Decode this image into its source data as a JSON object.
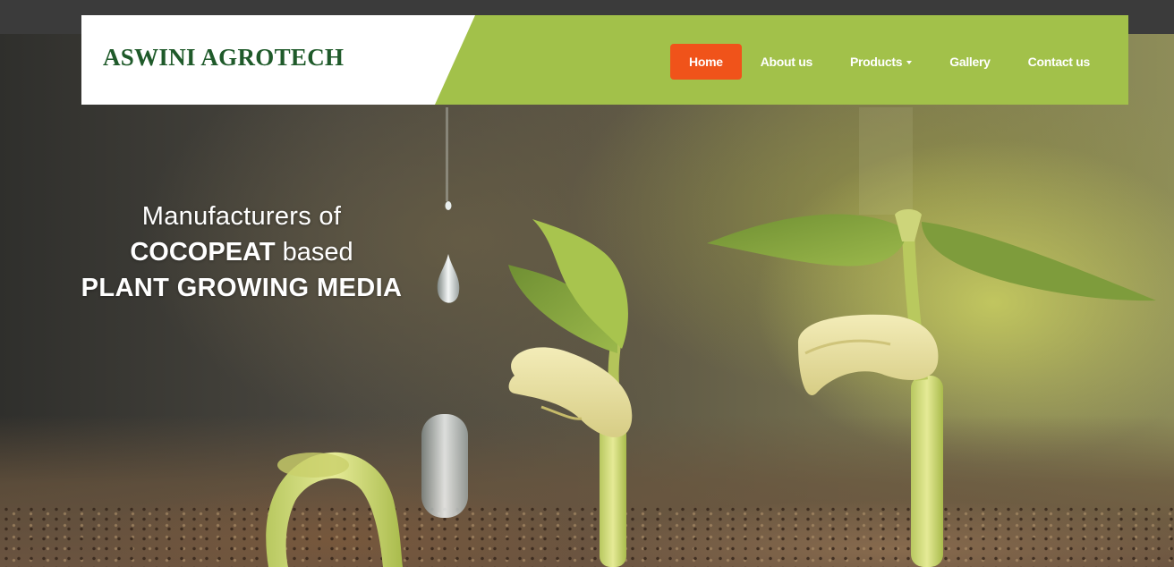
{
  "brand": {
    "name": "ASWINI AGROTECH"
  },
  "nav": {
    "items": [
      {
        "label": "Home",
        "active": true
      },
      {
        "label": "About us"
      },
      {
        "label": "Products",
        "has_dropdown": true
      },
      {
        "label": "Gallery"
      },
      {
        "label": "Contact us"
      }
    ]
  },
  "hero": {
    "line1": "Manufacturers of",
    "line2_bold": "COCOPEAT",
    "line2_rest": " based",
    "line3": "PLANT GROWING MEDIA"
  },
  "colors": {
    "header_green": "#a2c14a",
    "brand_text": "#1f5a2a",
    "active_nav": "#f0531a"
  }
}
